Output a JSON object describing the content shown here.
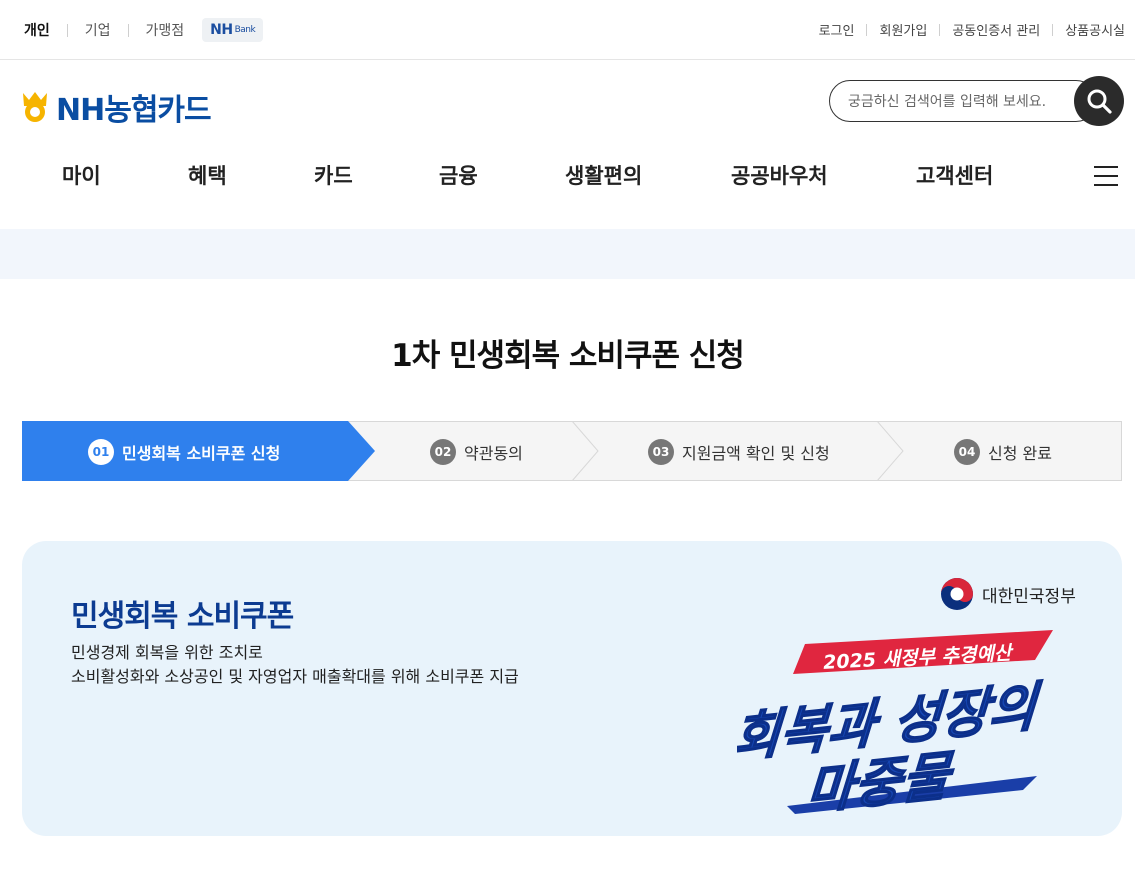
{
  "topbar": {
    "segments": [
      "개인",
      "기업",
      "가맹점"
    ],
    "nhbank": "NH",
    "nhbank_small": "Bank",
    "util_links": [
      "로그인",
      "회원가입",
      "공동인증서 관리",
      "상품공시실"
    ]
  },
  "header": {
    "logo_text": "NH농협카드",
    "search_placeholder": "궁금하신 검색어를 입력해 보세요."
  },
  "nav": {
    "items": [
      "마이",
      "혜택",
      "카드",
      "금융",
      "생활편의",
      "공공바우처",
      "고객센터"
    ]
  },
  "page": {
    "title": "1차 민생회복 소비쿠폰 신청"
  },
  "steps": [
    {
      "num": "01",
      "label": "민생회복 소비쿠폰 신청"
    },
    {
      "num": "02",
      "label": "약관동의"
    },
    {
      "num": "03",
      "label": "지원금액 확인 및 신청"
    },
    {
      "num": "04",
      "label": "신청 완료"
    }
  ],
  "banner": {
    "title": "민생회복 소비쿠폰",
    "desc_line1": "민생경제 회복을 위한 조치로",
    "desc_line2": "소비활성화와 소상공인 및 자영업자 매출확대를 위해 소비쿠폰 지급",
    "gov_label": "대한민국정부",
    "promo_tag": "2025 새정부 추경예산",
    "promo_line1": "회복과 성장의",
    "promo_line2": "마중물"
  },
  "colors": {
    "brand_blue": "#0a4da2",
    "step_active": "#2f80ed",
    "banner_bg": "#e8f3fb",
    "promo_red": "#e0263f"
  }
}
